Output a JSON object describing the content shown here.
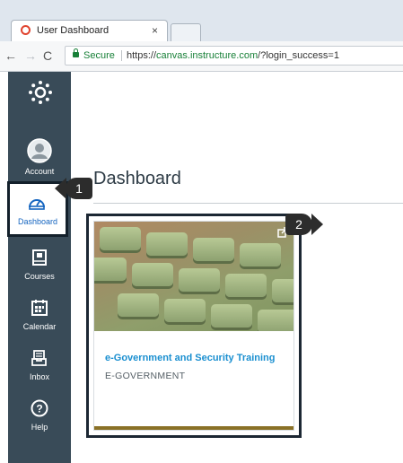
{
  "browser": {
    "tab_title": "User Dashboard",
    "tab_close": "×",
    "nav": {
      "back": "←",
      "forward": "→",
      "reload": "C"
    },
    "secure_label": "Secure",
    "url_scheme": "https://",
    "url_host": "canvas.instructure.com",
    "url_path": "/?login_success=1"
  },
  "globalnav": {
    "items": [
      {
        "label": "Account",
        "icon": "user-icon"
      },
      {
        "label": "Dashboard",
        "icon": "gauge-icon",
        "active": true
      },
      {
        "label": "Courses",
        "icon": "book-icon"
      },
      {
        "label": "Calendar",
        "icon": "calendar-icon"
      },
      {
        "label": "Inbox",
        "icon": "inbox-icon"
      },
      {
        "label": "Help",
        "icon": "help-icon"
      }
    ]
  },
  "main": {
    "title": "Dashboard"
  },
  "course_card": {
    "title": "e-Government and Security Training",
    "subtitle": "E-GOVERNMENT",
    "color": "#8a7126"
  },
  "callouts": [
    "1",
    "2"
  ],
  "colors": {
    "nav_bg": "#394b58",
    "link": "#1a8fd0",
    "active_label": "#1565c0"
  }
}
